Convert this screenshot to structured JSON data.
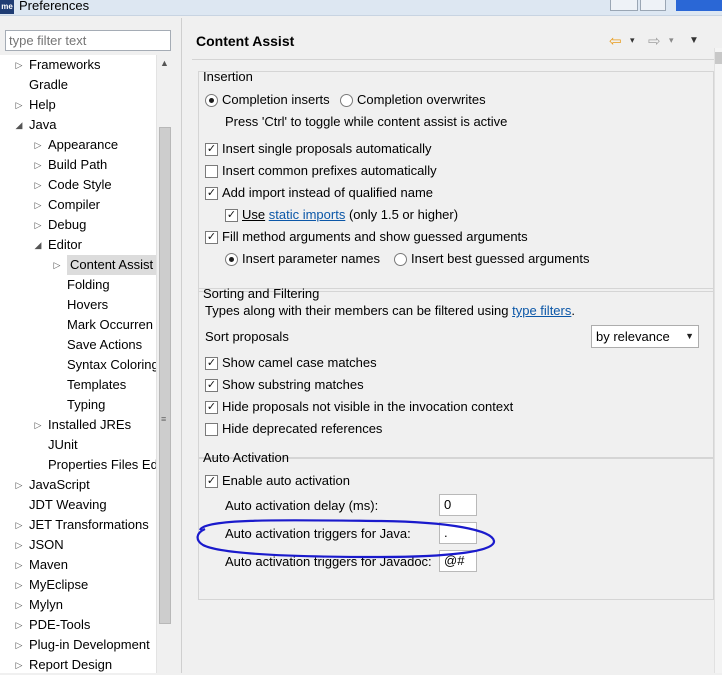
{
  "window": {
    "icon_text": "me",
    "title": "Preferences"
  },
  "filter": {
    "placeholder": "type filter text"
  },
  "tree": {
    "items": [
      {
        "label": "Frameworks",
        "expander": "▷"
      },
      {
        "label": "Gradle",
        "expander": ""
      },
      {
        "label": "Help",
        "expander": "▷"
      },
      {
        "label": "Java",
        "expander": "◢"
      },
      {
        "label": "Appearance",
        "expander": "▷"
      },
      {
        "label": "Build Path",
        "expander": "▷"
      },
      {
        "label": "Code Style",
        "expander": "▷"
      },
      {
        "label": "Compiler",
        "expander": "▷"
      },
      {
        "label": "Debug",
        "expander": "▷"
      },
      {
        "label": "Editor",
        "expander": "◢"
      },
      {
        "label": "Content Assist",
        "expander": "▷"
      },
      {
        "label": "Folding",
        "expander": ""
      },
      {
        "label": "Hovers",
        "expander": ""
      },
      {
        "label": "Mark Occurren",
        "expander": ""
      },
      {
        "label": "Save Actions",
        "expander": ""
      },
      {
        "label": "Syntax Coloring",
        "expander": ""
      },
      {
        "label": "Templates",
        "expander": ""
      },
      {
        "label": "Typing",
        "expander": ""
      },
      {
        "label": "Installed JREs",
        "expander": "▷"
      },
      {
        "label": "JUnit",
        "expander": ""
      },
      {
        "label": "Properties Files Ed",
        "expander": ""
      },
      {
        "label": "JavaScript",
        "expander": "▷"
      },
      {
        "label": "JDT Weaving",
        "expander": ""
      },
      {
        "label": "JET Transformations",
        "expander": "▷"
      },
      {
        "label": "JSON",
        "expander": "▷"
      },
      {
        "label": "Maven",
        "expander": "▷"
      },
      {
        "label": "MyEclipse",
        "expander": "▷"
      },
      {
        "label": "Mylyn",
        "expander": "▷"
      },
      {
        "label": "PDE-Tools",
        "expander": "▷"
      },
      {
        "label": "Plug-in Development",
        "expander": "▷"
      },
      {
        "label": "Report Design",
        "expander": "▷"
      }
    ]
  },
  "page": {
    "title": "Content Assist",
    "nav_back": "⇦",
    "nav_fwd": "⇨",
    "dropdown_glyph": "▾",
    "view_menu_glyph": "▼"
  },
  "insertion": {
    "title": "Insertion",
    "completion_inserts": "Completion inserts",
    "completion_overwrites": "Completion overwrites",
    "toggle_hint": "Press 'Ctrl' to toggle while content assist is active",
    "insert_single": "Insert single proposals automatically",
    "insert_common": "Insert common prefixes automatically",
    "add_import": "Add import instead of qualified name",
    "use_static_use": "Use",
    "use_static_link": "static imports",
    "use_static_suffix": "(only 1.5 or higher)",
    "fill_method": "Fill method arguments and show guessed arguments",
    "insert_param_names": "Insert parameter names",
    "insert_best_guessed": "Insert best guessed arguments"
  },
  "sorting": {
    "title": "Sorting and Filtering",
    "types_text": "Types along with their members can be filtered using",
    "types_link": "type filters",
    "types_period": ".",
    "sort_proposals": "Sort proposals",
    "sort_value": "by relevance",
    "camel_case": "Show camel case matches",
    "substring": "Show substring matches",
    "hide_not_visible": "Hide proposals not visible in the invocation context",
    "hide_deprecated": "Hide deprecated references"
  },
  "auto_activation": {
    "title": "Auto Activation",
    "enable": "Enable auto activation",
    "delay_label": "Auto activation delay (ms):",
    "delay_value": "0",
    "java_triggers_label": "Auto activation triggers for Java:",
    "java_triggers_value": ".",
    "javadoc_triggers_label": "Auto activation triggers for Javadoc:",
    "javadoc_triggers_value": "@#"
  },
  "state": {
    "checked_glyph": "✓",
    "highlight_color": "#1a1acc"
  }
}
